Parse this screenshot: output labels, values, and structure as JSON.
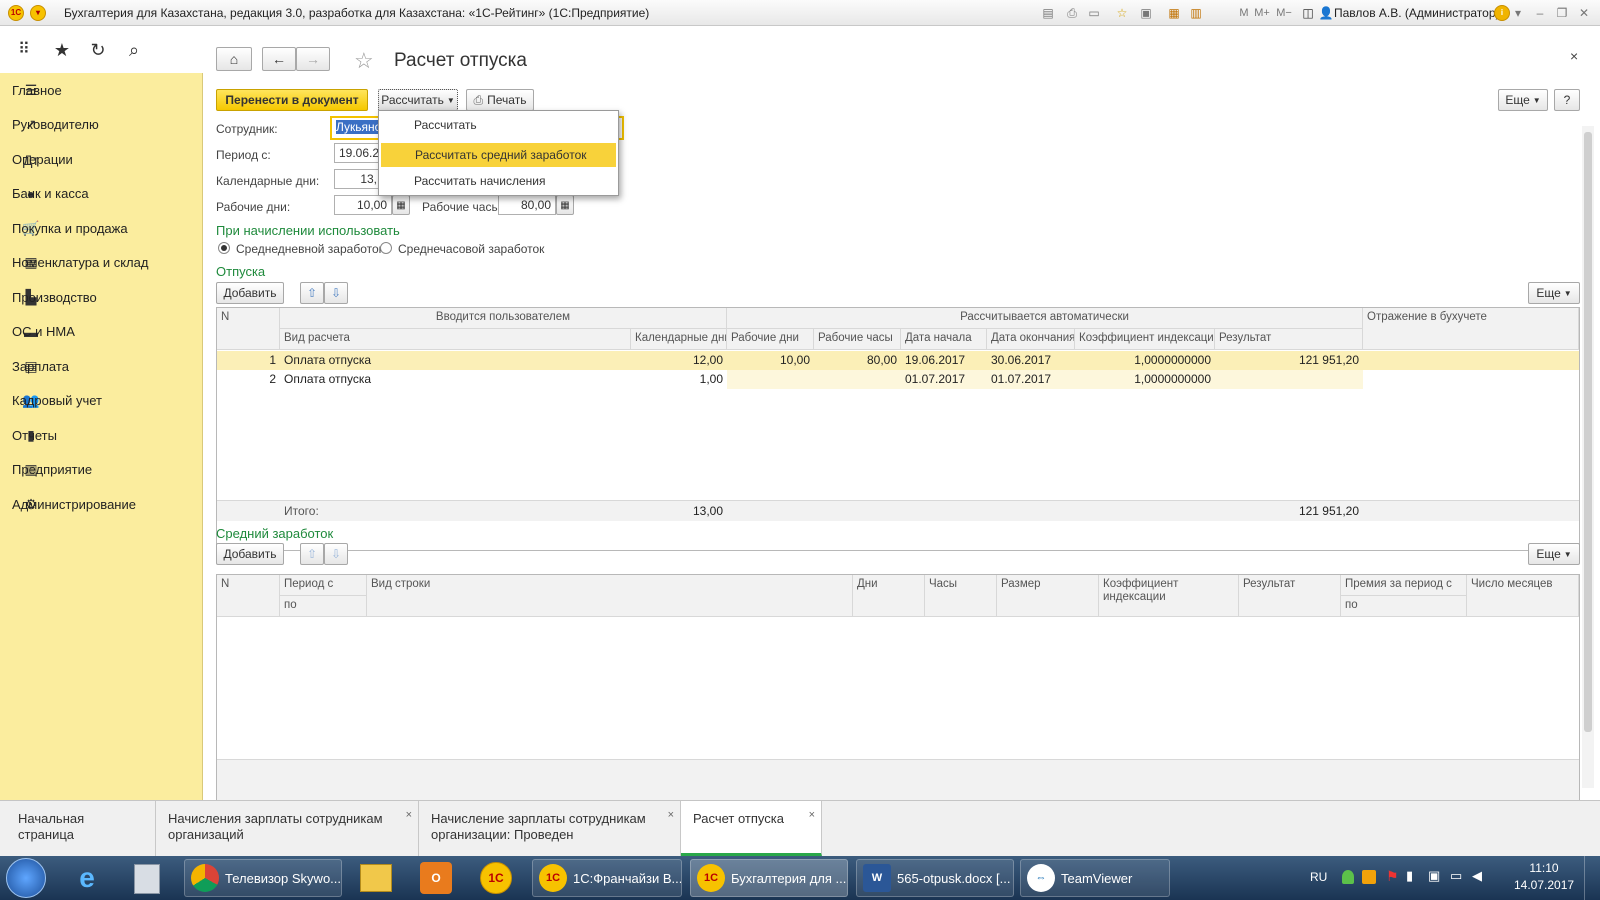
{
  "window": {
    "title": "Бухгалтерия для Казахстана, редакция 3.0, разработка для Казахстана: «1С-Рейтинг» (1С:Предприятие)",
    "user": "Павлов А.В. (Администратор)"
  },
  "sidebar": {
    "items": [
      {
        "label": "Главное",
        "icon": "menu-icon"
      },
      {
        "label": "Руководителю",
        "icon": "trend-icon"
      },
      {
        "label": "Операции",
        "icon": "operations-icon"
      },
      {
        "label": "Банк и касса",
        "icon": "bank-icon"
      },
      {
        "label": "Покупка и продажа",
        "icon": "cart-icon"
      },
      {
        "label": "Номенклатура и склад",
        "icon": "grid-icon"
      },
      {
        "label": "Производство",
        "icon": "factory-icon"
      },
      {
        "label": "ОС и НМА",
        "icon": "truck-icon"
      },
      {
        "label": "Зарплата",
        "icon": "salary-icon"
      },
      {
        "label": "Кадровый учет",
        "icon": "people-icon"
      },
      {
        "label": "Отчеты",
        "icon": "report-icon"
      },
      {
        "label": "Предприятие",
        "icon": "enterprise-icon"
      },
      {
        "label": "Администрирование",
        "icon": "gear-icon"
      }
    ]
  },
  "form": {
    "title": "Расчет отпуска",
    "btn_transfer": "Перенести в документ",
    "btn_calc": "Рассчитать",
    "btn_print": "Печать",
    "btn_more": "Еще",
    "btn_help": "?",
    "employee_label": "Сотрудник:",
    "employee_value": "Лукьянов",
    "period_label": "Период с:",
    "period_value": "19.06.20",
    "calendar_days_label": "Календарные дни:",
    "calendar_days_value": "13,",
    "work_days_label": "Рабочие дни:",
    "work_days_value": "10,00",
    "work_hours_label": "Рабочие часы:",
    "work_hours_value": "80,00",
    "use_section": "При начислении использовать",
    "radio1": "Среднедневной заработок",
    "radio2": "Среднечасовой заработок"
  },
  "dropdown": {
    "items": [
      "Рассчитать",
      "Рассчитать средний заработок",
      "Рассчитать начисления"
    ]
  },
  "vacations": {
    "section": "Отпуска",
    "add": "Добавить",
    "more": "Еще",
    "group_user": "Вводится пользователем",
    "group_auto": "Рассчитывается автоматически",
    "headers": {
      "n": "N",
      "type": "Вид расчета",
      "cal_days": "Календарные дни",
      "work_days": "Рабочие дни",
      "work_hours": "Рабочие часы",
      "date_start": "Дата начала",
      "date_end": "Дата окончания",
      "coef": "Коэффициент индексации",
      "result": "Результат",
      "reflection": "Отражение в бухучете"
    },
    "rows": [
      {
        "n": "1",
        "type": "Оплата отпуска",
        "cal_days": "12,00",
        "work_days": "10,00",
        "work_hours": "80,00",
        "date_start": "19.06.2017",
        "date_end": "30.06.2017",
        "coef": "1,0000000000",
        "result": "121 951,20"
      },
      {
        "n": "2",
        "type": "Оплата отпуска",
        "cal_days": "1,00",
        "work_days": "",
        "work_hours": "",
        "date_start": "01.07.2017",
        "date_end": "01.07.2017",
        "coef": "1,0000000000",
        "result": ""
      }
    ],
    "total_label": "Итого:",
    "total_days": "13,00",
    "total_result": "121 951,20"
  },
  "avg": {
    "section": "Средний заработок",
    "add": "Добавить",
    "more": "Еще",
    "headers": {
      "n": "N",
      "period": "Период с",
      "period_to": "по",
      "row_type": "Вид строки",
      "days": "Дни",
      "hours": "Часы",
      "size": "Размер",
      "coef": "Коэффициент индексации",
      "result": "Результат",
      "bonus": "Премия за период с",
      "bonus_to": "по",
      "months": "Число месяцев"
    }
  },
  "tabs": [
    {
      "label": "Начальная страница"
    },
    {
      "label": "Начисления зарплаты сотрудникам организаций"
    },
    {
      "label": "Начисление зарплаты сотрудникам организации: Проведен"
    },
    {
      "label": "Расчет отпуска"
    }
  ],
  "taskbar": {
    "items": [
      "Телевизор Skywo...",
      "1С:Франчайзи В...",
      "Бухгалтерия для ...",
      "565-otpusk.docx [...",
      "TeamViewer"
    ],
    "lang": "RU",
    "time": "11:10",
    "date": "14.07.2017"
  }
}
